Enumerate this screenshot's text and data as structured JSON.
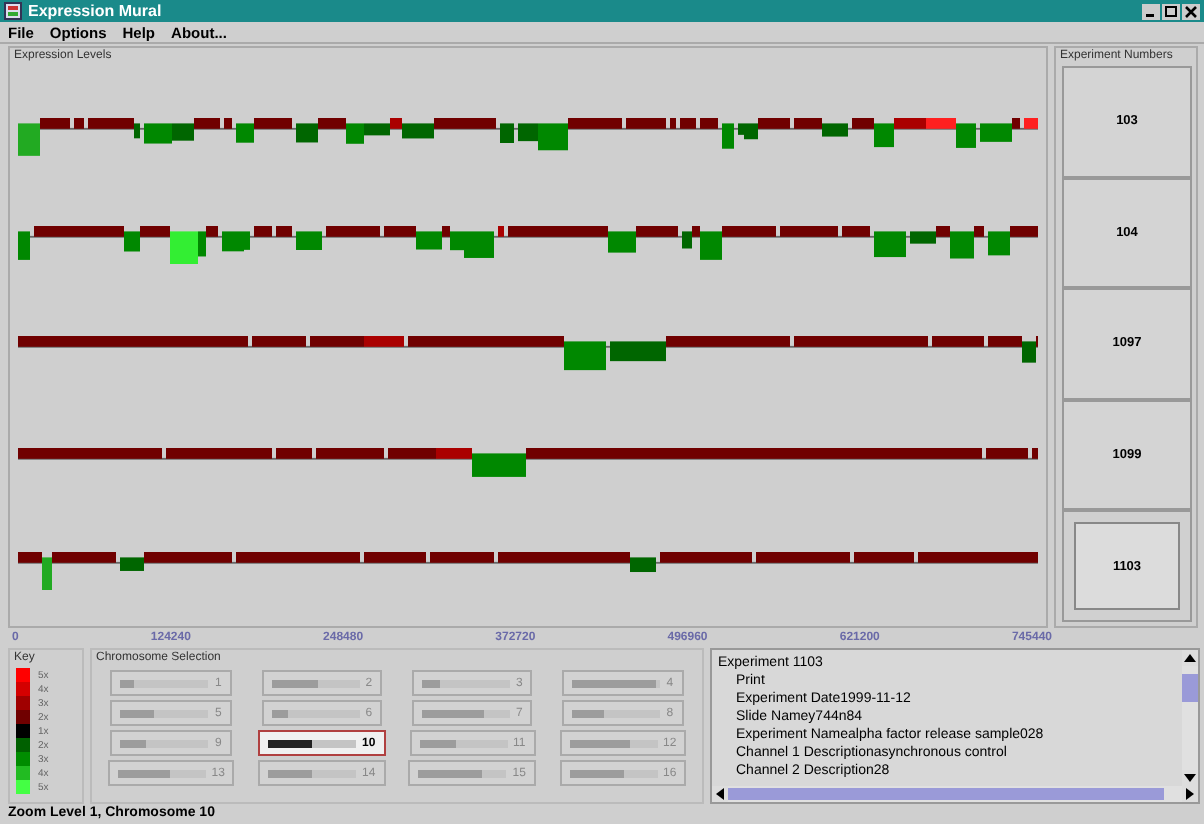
{
  "window": {
    "title": "Expression Mural"
  },
  "menu": [
    "File",
    "Options",
    "Help",
    "About..."
  ],
  "expression_panel": {
    "title": "Expression Levels"
  },
  "experiment_panel": {
    "title": "Experiment Numbers",
    "experiments": [
      {
        "number": "103",
        "selected": false
      },
      {
        "number": "104",
        "selected": false
      },
      {
        "number": "1097",
        "selected": false
      },
      {
        "number": "1099",
        "selected": false
      },
      {
        "number": "1103",
        "selected": true
      }
    ]
  },
  "axis": {
    "ticks": [
      "0",
      "124240",
      "248480",
      "372720",
      "496960",
      "621200",
      "745440"
    ]
  },
  "key": {
    "title": "Key",
    "items": [
      {
        "label": "5x",
        "color": "#ff0000"
      },
      {
        "label": "4x",
        "color": "#d40000"
      },
      {
        "label": "3x",
        "color": "#a00000"
      },
      {
        "label": "2x",
        "color": "#700000"
      },
      {
        "label": "1x",
        "color": "#000000"
      },
      {
        "label": "2x",
        "color": "#006000"
      },
      {
        "label": "3x",
        "color": "#008c00"
      },
      {
        "label": "4x",
        "color": "#22bb22"
      },
      {
        "label": "5x",
        "color": "#44ff44"
      }
    ]
  },
  "chromosome_selection": {
    "title": "Chromosome Selection",
    "buttons": [
      {
        "number": "1",
        "level": 0.15,
        "selected": false
      },
      {
        "number": "2",
        "level": 0.53,
        "selected": false
      },
      {
        "number": "3",
        "level": 0.2,
        "selected": false
      },
      {
        "number": "4",
        "level": 0.95,
        "selected": false
      },
      {
        "number": "5",
        "level": 0.38,
        "selected": false
      },
      {
        "number": "6",
        "level": 0.18,
        "selected": false
      },
      {
        "number": "7",
        "level": 0.71,
        "selected": false
      },
      {
        "number": "8",
        "level": 0.37,
        "selected": false
      },
      {
        "number": "9",
        "level": 0.29,
        "selected": false
      },
      {
        "number": "10",
        "level": 0.49,
        "selected": true
      },
      {
        "number": "11",
        "level": 0.43,
        "selected": false
      },
      {
        "number": "12",
        "level": 0.7,
        "selected": false
      },
      {
        "number": "13",
        "level": 0.6,
        "selected": false
      },
      {
        "number": "14",
        "level": 0.51,
        "selected": false
      },
      {
        "number": "15",
        "level": 0.71,
        "selected": false
      },
      {
        "number": "16",
        "level": 0.62,
        "selected": false
      }
    ]
  },
  "details": {
    "heading": "Experiment 1103",
    "lines": [
      "Print",
      "Experiment Date1999-11-12",
      "Slide Namey744n84",
      "Experiment Namealpha factor release sample028",
      "Channel 1 Descriptionasynchronous control",
      "Channel 2 Description28"
    ]
  },
  "status_bar": "Zoom Level 1, Chromosome 10"
}
